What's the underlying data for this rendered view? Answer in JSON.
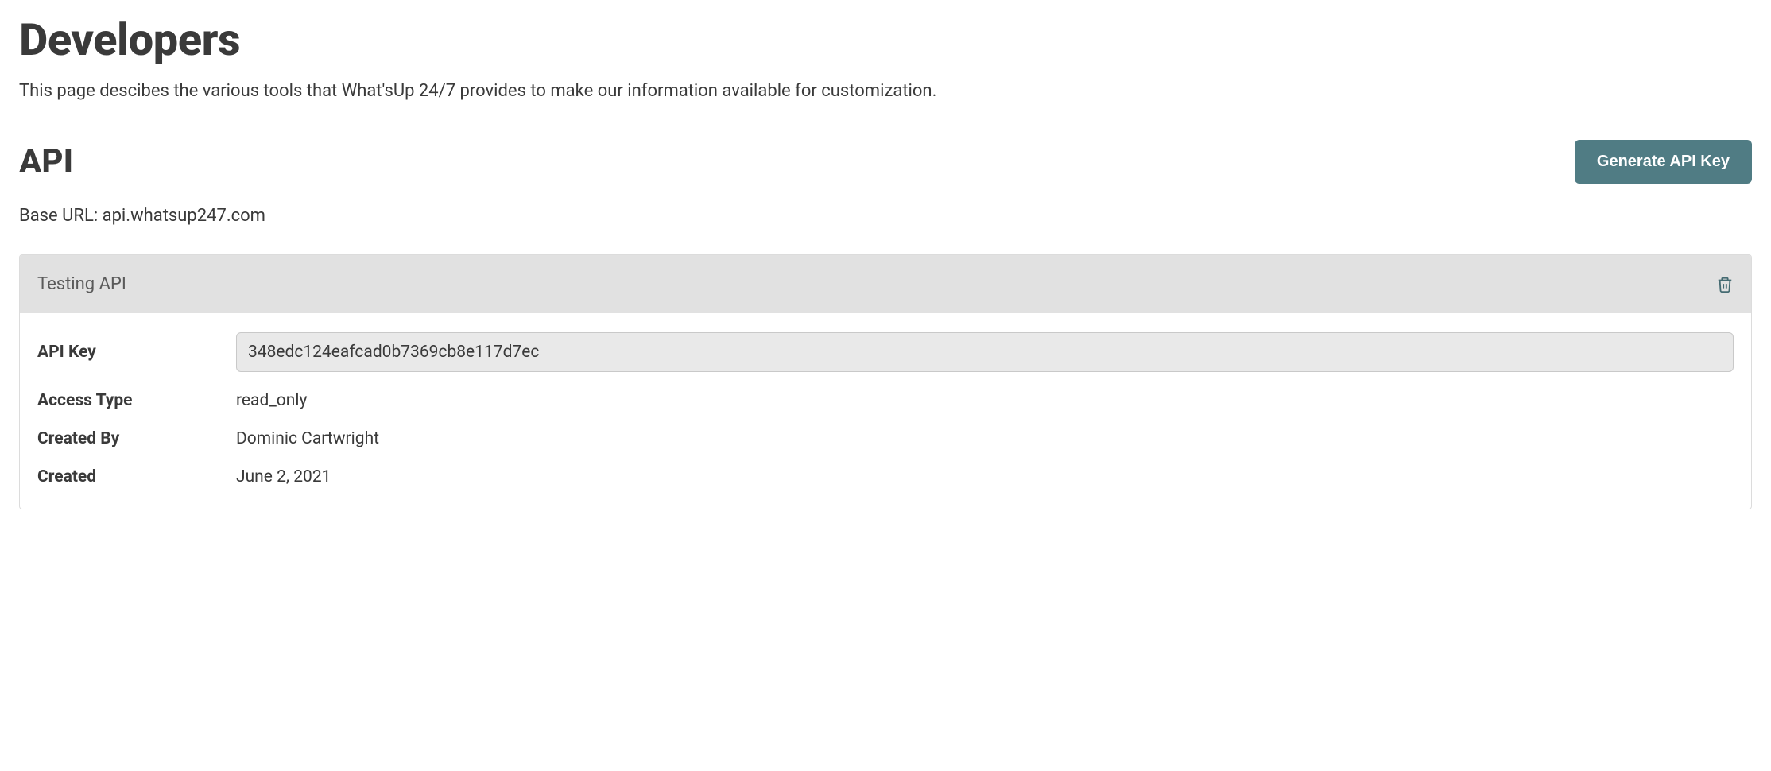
{
  "page": {
    "title": "Developers",
    "description": "This page descibes the various tools that What'sUp 24/7 provides to make our information available for customization."
  },
  "api": {
    "heading": "API",
    "generate_button": "Generate API Key",
    "base_url_label": "Base URL: ",
    "base_url_value": "api.whatsup247.com"
  },
  "card": {
    "title": "Testing API",
    "labels": {
      "api_key": "API Key",
      "access_type": "Access Type",
      "created_by": "Created By",
      "created": "Created"
    },
    "values": {
      "api_key": "348edc124eafcad0b7369cb8e117d7ec",
      "access_type": "read_only",
      "created_by": "Dominic Cartwright",
      "created": "June 2, 2021"
    }
  }
}
